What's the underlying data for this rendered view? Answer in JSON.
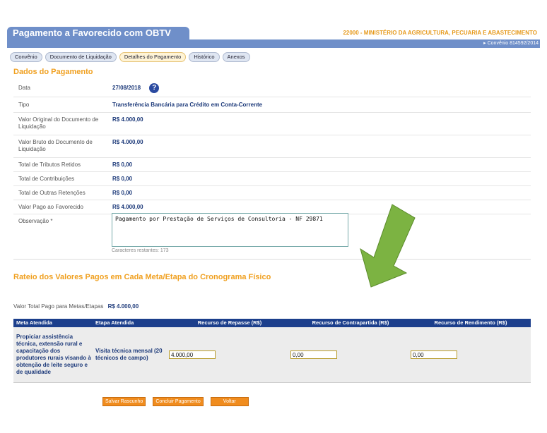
{
  "header": {
    "title": "Pagamento a Favorecido com OBTV",
    "ministry": "22000 - MINISTÉRIO DA AGRICULTURA, PECUARIA E ABASTECIMENTO",
    "convenio": "▸ Convênio 814592/2014"
  },
  "tabs": [
    {
      "label": "Convênio"
    },
    {
      "label": "Documento de Liquidação"
    },
    {
      "label": "Detalhes do Pagamento"
    },
    {
      "label": "Histórico"
    },
    {
      "label": "Anexos"
    }
  ],
  "dados": {
    "title": "Dados do Pagamento",
    "rows": [
      {
        "label": "Data",
        "value": "27/08/2018"
      },
      {
        "label": "Tipo",
        "value": "Transferência Bancária para Crédito em Conta-Corrente"
      },
      {
        "label": "Valor Original do Documento de Liquidação",
        "value": "R$ 4.000,00"
      },
      {
        "label": "Valor Bruto do Documento de Liquidação",
        "value": "R$ 4.000,00"
      },
      {
        "label": "Total de Tributos Retidos",
        "value": "R$ 0,00"
      },
      {
        "label": "Total de Contribuições",
        "value": "R$ 0,00"
      },
      {
        "label": "Total de Outras Retenções",
        "value": "R$ 0,00"
      },
      {
        "label": "Valor Pago ao Favorecido",
        "value": "R$ 4.000,00"
      }
    ],
    "observacao_label": "Observação *",
    "observacao_value": "Pagamento por Prestação de Serviços de Consultoria - NF 29871",
    "chars_remaining": "Caracteres restantes: 173",
    "help_icon": "?"
  },
  "rateio": {
    "title": "Rateio dos Valores Pagos em Cada Meta/Etapa do Cronograma Físico",
    "total_label": "Valor Total Pago para Metas/Etapas",
    "total_value": "R$ 4.000,00",
    "headers": [
      "Meta Atendida",
      "Etapa Atendida",
      "Recurso de Repasse (R$)",
      "Recurso de Contrapartida (R$)",
      "Recurso de Rendimento (R$)"
    ],
    "row": {
      "meta": "Propiciar assistência técnica, extensão rural e capacitação dos produtores rurais visando à obtenção de leite seguro e de qualidade",
      "etapa": "Visita técnica mensal (20 técnicos de campo)",
      "repasse": "4.000,00",
      "contrapartida": "0,00",
      "rendimento": "0,00"
    }
  },
  "buttons": {
    "salvar": "Salvar Rascunho",
    "concluir": "Concluir Pagamento",
    "voltar": "Voltar"
  },
  "colors": {
    "accent": "#f0a020",
    "header": "#6f8fc9",
    "table_header": "#1c3f8c",
    "arrow": "#7cb342"
  }
}
